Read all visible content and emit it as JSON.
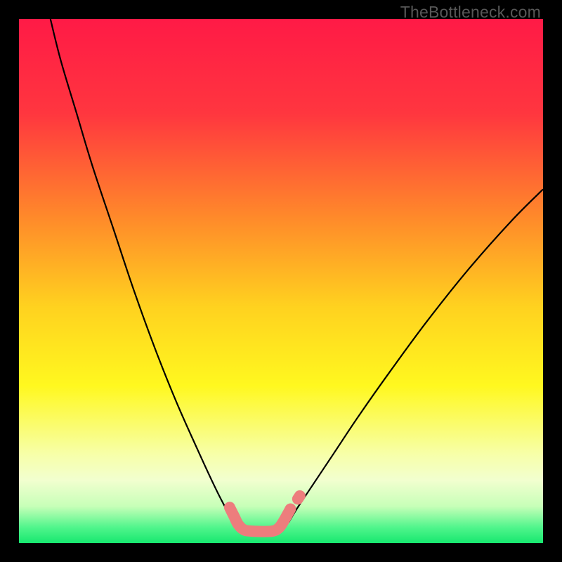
{
  "watermark": "TheBottleneck.com",
  "chart_data": {
    "type": "line",
    "title": "",
    "xlabel": "",
    "ylabel": "",
    "xlim": [
      0,
      100
    ],
    "ylim": [
      0,
      100
    ],
    "gradient_stops": [
      {
        "offset": 0,
        "color": "#ff1a46"
      },
      {
        "offset": 18,
        "color": "#ff363f"
      },
      {
        "offset": 38,
        "color": "#ff8a2a"
      },
      {
        "offset": 55,
        "color": "#ffd21f"
      },
      {
        "offset": 70,
        "color": "#fff81f"
      },
      {
        "offset": 83,
        "color": "#f7ffa8"
      },
      {
        "offset": 88,
        "color": "#f2ffcf"
      },
      {
        "offset": 93,
        "color": "#c7ffb8"
      },
      {
        "offset": 97,
        "color": "#51f58c"
      },
      {
        "offset": 100,
        "color": "#17e86f"
      }
    ],
    "series": [
      {
        "name": "left-curve",
        "stroke": "#000000",
        "width": 2.2,
        "points": [
          {
            "x": 6.0,
            "y": 100.0
          },
          {
            "x": 8.0,
            "y": 92.0
          },
          {
            "x": 11.0,
            "y": 82.0
          },
          {
            "x": 14.0,
            "y": 72.0
          },
          {
            "x": 18.0,
            "y": 60.0
          },
          {
            "x": 22.0,
            "y": 48.0
          },
          {
            "x": 26.0,
            "y": 37.0
          },
          {
            "x": 30.0,
            "y": 27.0
          },
          {
            "x": 34.0,
            "y": 18.0
          },
          {
            "x": 37.0,
            "y": 11.5
          },
          {
            "x": 39.0,
            "y": 7.5
          },
          {
            "x": 40.5,
            "y": 5.0
          },
          {
            "x": 41.5,
            "y": 3.5
          }
        ]
      },
      {
        "name": "right-curve",
        "stroke": "#000000",
        "width": 2.2,
        "points": [
          {
            "x": 51.5,
            "y": 4.0
          },
          {
            "x": 53.0,
            "y": 6.5
          },
          {
            "x": 56.0,
            "y": 11.0
          },
          {
            "x": 60.0,
            "y": 17.0
          },
          {
            "x": 65.0,
            "y": 24.5
          },
          {
            "x": 71.0,
            "y": 33.0
          },
          {
            "x": 78.0,
            "y": 42.5
          },
          {
            "x": 86.0,
            "y": 52.5
          },
          {
            "x": 94.0,
            "y": 61.5
          },
          {
            "x": 100.0,
            "y": 67.5
          }
        ]
      },
      {
        "name": "bottom-squiggle",
        "stroke": "#ed7d7d",
        "width": 16,
        "linecap": "round",
        "linejoin": "round",
        "points": [
          {
            "x": 40.2,
            "y": 6.8
          },
          {
            "x": 41.0,
            "y": 5.2
          },
          {
            "x": 41.8,
            "y": 3.6
          },
          {
            "x": 42.8,
            "y": 2.6
          },
          {
            "x": 44.0,
            "y": 2.3
          },
          {
            "x": 46.5,
            "y": 2.2
          },
          {
            "x": 48.5,
            "y": 2.3
          },
          {
            "x": 49.6,
            "y": 2.9
          },
          {
            "x": 50.4,
            "y": 4.0
          },
          {
            "x": 51.2,
            "y": 5.4
          },
          {
            "x": 51.8,
            "y": 6.5
          }
        ]
      },
      {
        "name": "bottom-dot",
        "stroke": "#ed7d7d",
        "width": 16,
        "linecap": "round",
        "points": [
          {
            "x": 53.2,
            "y": 8.4
          },
          {
            "x": 53.6,
            "y": 9.0
          }
        ]
      }
    ]
  }
}
